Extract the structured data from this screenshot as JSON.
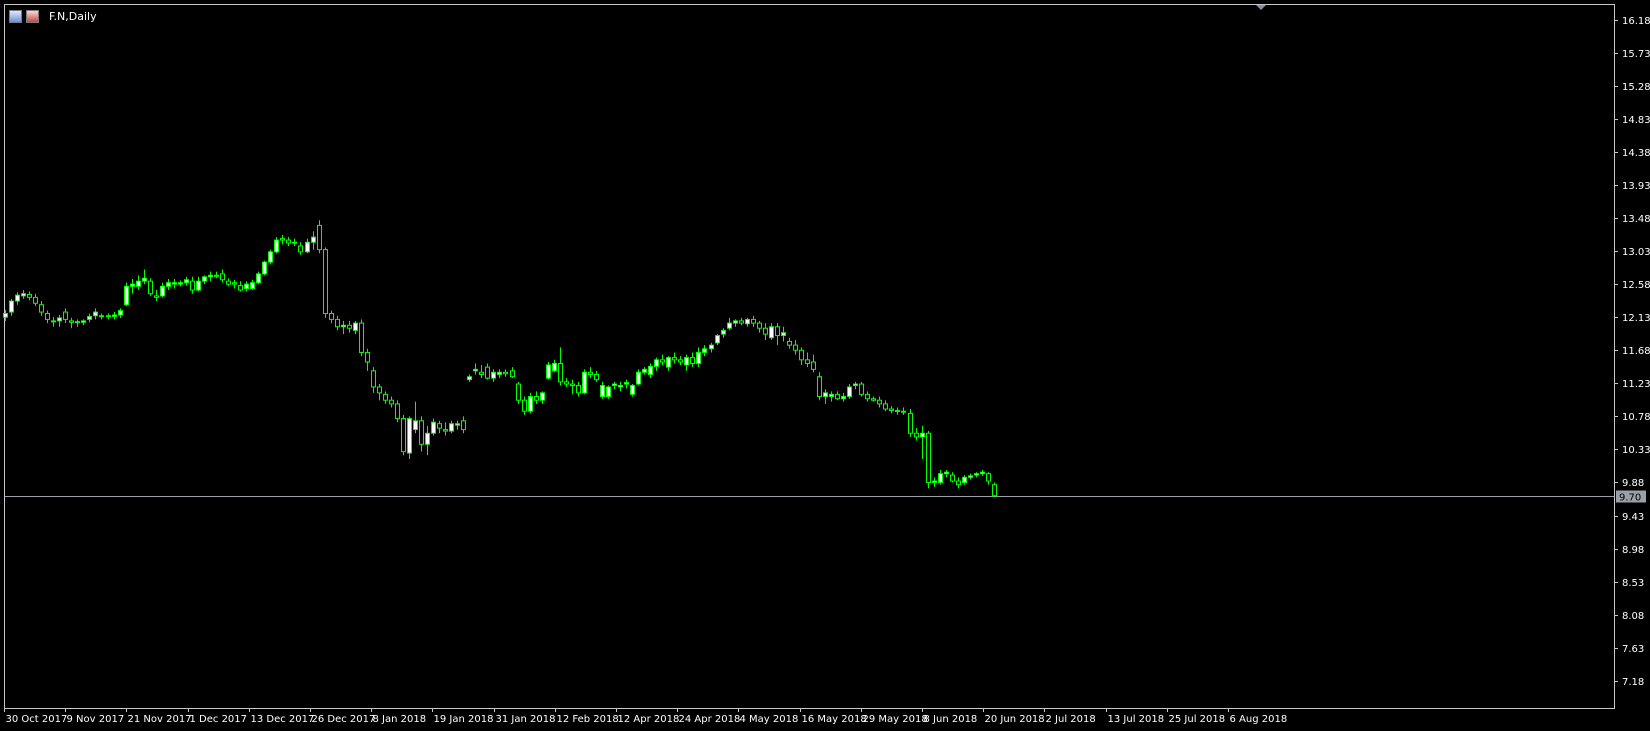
{
  "window": {
    "title": "F.N,Daily",
    "icons": [
      "chart-window-icon",
      "flag-icon"
    ]
  },
  "colors": {
    "background": "#000000",
    "frame": "#c8c8c8",
    "bull_candle": "#00ff00",
    "bull_body": "#ffffff",
    "bear_body": "#000000",
    "price_line": "#9aa0a8",
    "axis_text": "#ffffff"
  },
  "chart_data": {
    "type": "candlestick",
    "title": "F.N,Daily",
    "ylim": [
      6.81,
      16.38
    ],
    "y_ticks": [
      "16.18",
      "15.73",
      "15.28",
      "14.83",
      "14.38",
      "13.93",
      "13.48",
      "13.03",
      "12.58",
      "12.13",
      "11.68",
      "11.23",
      "10.78",
      "10.33",
      "9.88",
      "9.43",
      "8.98",
      "8.53",
      "8.08",
      "7.63",
      "7.18"
    ],
    "x_labels": [
      "30 Oct 2017",
      "9 Nov 2017",
      "21 Nov 2017",
      "1 Dec 2017",
      "13 Dec 2017",
      "26 Dec 2017",
      "8 Jan 2018",
      "19 Jan 2018",
      "31 Jan 2018",
      "12 Feb 2018",
      "12 Apr 2018",
      "24 Apr 2018",
      "4 May 2018",
      "16 May 2018",
      "29 May 2018",
      "8 Jun 2018",
      "20 Jun 2018",
      "2 Jul 2018",
      "13 Jul 2018",
      "25 Jul 2018",
      "6 Aug 2018"
    ],
    "current_price": "9.70",
    "candles": [
      {
        "o": 12.13,
        "h": 12.23,
        "l": 12.08,
        "c": 12.18
      },
      {
        "o": 12.2,
        "h": 12.38,
        "l": 12.15,
        "c": 12.35
      },
      {
        "o": 12.35,
        "h": 12.47,
        "l": 12.3,
        "c": 12.43
      },
      {
        "o": 12.42,
        "h": 12.5,
        "l": 12.38,
        "c": 12.45
      },
      {
        "o": 12.44,
        "h": 12.48,
        "l": 12.36,
        "c": 12.4
      },
      {
        "o": 12.4,
        "h": 12.45,
        "l": 12.28,
        "c": 12.32
      },
      {
        "o": 12.3,
        "h": 12.35,
        "l": 12.15,
        "c": 12.2
      },
      {
        "o": 12.18,
        "h": 12.22,
        "l": 12.05,
        "c": 12.1
      },
      {
        "o": 12.08,
        "h": 12.13,
        "l": 12.0,
        "c": 12.08
      },
      {
        "o": 12.08,
        "h": 12.16,
        "l": 12.0,
        "c": 12.12
      },
      {
        "o": 12.2,
        "h": 12.25,
        "l": 12.05,
        "c": 12.1
      },
      {
        "o": 12.08,
        "h": 12.12,
        "l": 11.98,
        "c": 12.06
      },
      {
        "o": 12.06,
        "h": 12.1,
        "l": 12.0,
        "c": 12.07
      },
      {
        "o": 12.06,
        "h": 12.1,
        "l": 12.02,
        "c": 12.08
      },
      {
        "o": 12.1,
        "h": 12.18,
        "l": 12.06,
        "c": 12.14
      },
      {
        "o": 12.15,
        "h": 12.25,
        "l": 12.1,
        "c": 12.2
      },
      {
        "o": 12.15,
        "h": 12.18,
        "l": 12.1,
        "c": 12.15
      },
      {
        "o": 12.15,
        "h": 12.18,
        "l": 12.1,
        "c": 12.14
      },
      {
        "o": 12.14,
        "h": 12.2,
        "l": 12.1,
        "c": 12.16
      },
      {
        "o": 12.16,
        "h": 12.25,
        "l": 12.12,
        "c": 12.22
      },
      {
        "o": 12.3,
        "h": 12.6,
        "l": 12.28,
        "c": 12.55
      },
      {
        "o": 12.55,
        "h": 12.65,
        "l": 12.45,
        "c": 12.58
      },
      {
        "o": 12.55,
        "h": 12.7,
        "l": 12.5,
        "c": 12.62
      },
      {
        "o": 12.62,
        "h": 12.78,
        "l": 12.58,
        "c": 12.66
      },
      {
        "o": 12.62,
        "h": 12.66,
        "l": 12.42,
        "c": 12.45
      },
      {
        "o": 12.42,
        "h": 12.5,
        "l": 12.35,
        "c": 12.4
      },
      {
        "o": 12.42,
        "h": 12.6,
        "l": 12.4,
        "c": 12.55
      },
      {
        "o": 12.55,
        "h": 12.65,
        "l": 12.5,
        "c": 12.6
      },
      {
        "o": 12.58,
        "h": 12.65,
        "l": 12.52,
        "c": 12.6
      },
      {
        "o": 12.58,
        "h": 12.63,
        "l": 12.55,
        "c": 12.6
      },
      {
        "o": 12.6,
        "h": 12.68,
        "l": 12.56,
        "c": 12.64
      },
      {
        "o": 12.62,
        "h": 12.68,
        "l": 12.45,
        "c": 12.5
      },
      {
        "o": 12.5,
        "h": 12.68,
        "l": 12.48,
        "c": 12.62
      },
      {
        "o": 12.62,
        "h": 12.7,
        "l": 12.58,
        "c": 12.68
      },
      {
        "o": 12.68,
        "h": 12.75,
        "l": 12.62,
        "c": 12.7
      },
      {
        "o": 12.7,
        "h": 12.75,
        "l": 12.66,
        "c": 12.7
      },
      {
        "o": 12.72,
        "h": 12.78,
        "l": 12.6,
        "c": 12.64
      },
      {
        "o": 12.62,
        "h": 12.66,
        "l": 12.55,
        "c": 12.58
      },
      {
        "o": 12.6,
        "h": 12.64,
        "l": 12.52,
        "c": 12.58
      },
      {
        "o": 12.56,
        "h": 12.62,
        "l": 12.48,
        "c": 12.5
      },
      {
        "o": 12.52,
        "h": 12.62,
        "l": 12.48,
        "c": 12.58
      },
      {
        "o": 12.52,
        "h": 12.64,
        "l": 12.5,
        "c": 12.6
      },
      {
        "o": 12.6,
        "h": 12.75,
        "l": 12.58,
        "c": 12.72
      },
      {
        "o": 12.72,
        "h": 12.9,
        "l": 12.7,
        "c": 12.88
      },
      {
        "o": 12.88,
        "h": 13.05,
        "l": 12.85,
        "c": 13.02
      },
      {
        "o": 13.02,
        "h": 13.22,
        "l": 13.0,
        "c": 13.18
      },
      {
        "o": 13.2,
        "h": 13.25,
        "l": 13.12,
        "c": 13.18
      },
      {
        "o": 13.18,
        "h": 13.22,
        "l": 13.1,
        "c": 13.14
      },
      {
        "o": 13.14,
        "h": 13.2,
        "l": 13.1,
        "c": 13.15
      },
      {
        "o": 13.1,
        "h": 13.15,
        "l": 12.98,
        "c": 13.02
      },
      {
        "o": 13.02,
        "h": 13.2,
        "l": 13.0,
        "c": 13.15
      },
      {
        "o": 13.15,
        "h": 13.3,
        "l": 13.05,
        "c": 13.22
      },
      {
        "o": 13.38,
        "h": 13.45,
        "l": 13.0,
        "c": 13.05
      },
      {
        "o": 13.05,
        "h": 13.08,
        "l": 12.12,
        "c": 12.18
      },
      {
        "o": 12.18,
        "h": 12.22,
        "l": 12.05,
        "c": 12.1
      },
      {
        "o": 12.1,
        "h": 12.15,
        "l": 11.95,
        "c": 12.0
      },
      {
        "o": 12.0,
        "h": 12.08,
        "l": 11.9,
        "c": 12.02
      },
      {
        "o": 12.02,
        "h": 12.08,
        "l": 11.92,
        "c": 11.98
      },
      {
        "o": 11.95,
        "h": 12.08,
        "l": 11.9,
        "c": 12.05
      },
      {
        "o": 12.05,
        "h": 12.1,
        "l": 11.6,
        "c": 11.65
      },
      {
        "o": 11.65,
        "h": 11.7,
        "l": 11.4,
        "c": 11.52
      },
      {
        "o": 11.4,
        "h": 11.45,
        "l": 11.1,
        "c": 11.18
      },
      {
        "o": 11.18,
        "h": 11.22,
        "l": 11.0,
        "c": 11.1
      },
      {
        "o": 11.08,
        "h": 11.12,
        "l": 10.95,
        "c": 11.0
      },
      {
        "o": 11.0,
        "h": 11.05,
        "l": 10.9,
        "c": 10.95
      },
      {
        "o": 10.95,
        "h": 11.0,
        "l": 10.7,
        "c": 10.75
      },
      {
        "o": 10.75,
        "h": 10.8,
        "l": 10.25,
        "c": 10.3
      },
      {
        "o": 10.28,
        "h": 10.78,
        "l": 10.2,
        "c": 10.75
      },
      {
        "o": 10.6,
        "h": 10.98,
        "l": 10.55,
        "c": 10.72
      },
      {
        "o": 10.72,
        "h": 10.78,
        "l": 10.3,
        "c": 10.4
      },
      {
        "o": 10.4,
        "h": 10.65,
        "l": 10.25,
        "c": 10.55
      },
      {
        "o": 10.55,
        "h": 10.75,
        "l": 10.52,
        "c": 10.7
      },
      {
        "o": 10.68,
        "h": 10.72,
        "l": 10.55,
        "c": 10.62
      },
      {
        "o": 10.6,
        "h": 10.7,
        "l": 10.52,
        "c": 10.58
      },
      {
        "o": 10.58,
        "h": 10.72,
        "l": 10.55,
        "c": 10.68
      },
      {
        "o": 10.66,
        "h": 10.72,
        "l": 10.6,
        "c": 10.68
      },
      {
        "o": 10.72,
        "h": 10.78,
        "l": 10.55,
        "c": 10.6
      },
      {
        "o": 11.28,
        "h": 11.35,
        "l": 11.25,
        "c": 11.32
      },
      {
        "o": 11.4,
        "h": 11.5,
        "l": 11.35,
        "c": 11.42
      },
      {
        "o": 11.38,
        "h": 11.48,
        "l": 11.3,
        "c": 11.35
      },
      {
        "o": 11.45,
        "h": 11.5,
        "l": 11.28,
        "c": 11.3
      },
      {
        "o": 11.3,
        "h": 11.42,
        "l": 11.25,
        "c": 11.38
      },
      {
        "o": 11.35,
        "h": 11.42,
        "l": 11.3,
        "c": 11.38
      },
      {
        "o": 11.38,
        "h": 11.42,
        "l": 11.32,
        "c": 11.36
      },
      {
        "o": 11.4,
        "h": 11.45,
        "l": 11.3,
        "c": 11.32
      },
      {
        "o": 11.22,
        "h": 11.25,
        "l": 10.95,
        "c": 11.0
      },
      {
        "o": 11.0,
        "h": 11.05,
        "l": 10.8,
        "c": 10.85
      },
      {
        "o": 10.85,
        "h": 11.1,
        "l": 10.82,
        "c": 11.05
      },
      {
        "o": 11.05,
        "h": 11.12,
        "l": 10.95,
        "c": 11.0
      },
      {
        "o": 11.0,
        "h": 11.12,
        "l": 10.95,
        "c": 11.1
      },
      {
        "o": 11.3,
        "h": 11.52,
        "l": 11.28,
        "c": 11.48
      },
      {
        "o": 11.4,
        "h": 11.55,
        "l": 11.38,
        "c": 11.5
      },
      {
        "o": 11.5,
        "h": 11.72,
        "l": 11.2,
        "c": 11.25
      },
      {
        "o": 11.25,
        "h": 11.3,
        "l": 11.18,
        "c": 11.22
      },
      {
        "o": 11.22,
        "h": 11.28,
        "l": 11.08,
        "c": 11.2
      },
      {
        "o": 11.2,
        "h": 11.25,
        "l": 11.05,
        "c": 11.1
      },
      {
        "o": 11.1,
        "h": 11.42,
        "l": 11.08,
        "c": 11.38
      },
      {
        "o": 11.38,
        "h": 11.45,
        "l": 11.3,
        "c": 11.35
      },
      {
        "o": 11.35,
        "h": 11.4,
        "l": 11.25,
        "c": 11.28
      },
      {
        "o": 11.05,
        "h": 11.25,
        "l": 11.02,
        "c": 11.2
      },
      {
        "o": 11.05,
        "h": 11.2,
        "l": 11.02,
        "c": 11.18
      },
      {
        "o": 11.2,
        "h": 11.25,
        "l": 11.15,
        "c": 11.22
      },
      {
        "o": 11.18,
        "h": 11.25,
        "l": 11.12,
        "c": 11.2
      },
      {
        "o": 11.22,
        "h": 11.28,
        "l": 11.16,
        "c": 11.24
      },
      {
        "o": 11.08,
        "h": 11.22,
        "l": 11.05,
        "c": 11.2
      },
      {
        "o": 11.22,
        "h": 11.42,
        "l": 11.2,
        "c": 11.38
      },
      {
        "o": 11.38,
        "h": 11.45,
        "l": 11.35,
        "c": 11.42
      },
      {
        "o": 11.35,
        "h": 11.5,
        "l": 11.3,
        "c": 11.46
      },
      {
        "o": 11.46,
        "h": 11.58,
        "l": 11.4,
        "c": 11.55
      },
      {
        "o": 11.55,
        "h": 11.62,
        "l": 11.48,
        "c": 11.52
      },
      {
        "o": 11.45,
        "h": 11.6,
        "l": 11.4,
        "c": 11.58
      },
      {
        "o": 11.58,
        "h": 11.65,
        "l": 11.5,
        "c": 11.55
      },
      {
        "o": 11.55,
        "h": 11.6,
        "l": 11.48,
        "c": 11.52
      },
      {
        "o": 11.48,
        "h": 11.62,
        "l": 11.4,
        "c": 11.58
      },
      {
        "o": 11.58,
        "h": 11.65,
        "l": 11.45,
        "c": 11.5
      },
      {
        "o": 11.5,
        "h": 11.72,
        "l": 11.45,
        "c": 11.65
      },
      {
        "o": 11.65,
        "h": 11.75,
        "l": 11.6,
        "c": 11.7
      },
      {
        "o": 11.7,
        "h": 11.78,
        "l": 11.65,
        "c": 11.75
      },
      {
        "o": 11.78,
        "h": 11.9,
        "l": 11.75,
        "c": 11.88
      },
      {
        "o": 11.9,
        "h": 11.98,
        "l": 11.85,
        "c": 11.95
      },
      {
        "o": 11.98,
        "h": 12.12,
        "l": 11.95,
        "c": 12.05
      },
      {
        "o": 12.05,
        "h": 12.1,
        "l": 12.0,
        "c": 12.08
      },
      {
        "o": 12.08,
        "h": 12.12,
        "l": 12.02,
        "c": 12.05
      },
      {
        "o": 12.04,
        "h": 12.12,
        "l": 12.0,
        "c": 12.1
      },
      {
        "o": 12.1,
        "h": 12.15,
        "l": 12.0,
        "c": 12.05
      },
      {
        "o": 12.05,
        "h": 12.08,
        "l": 11.92,
        "c": 11.98
      },
      {
        "o": 11.98,
        "h": 12.05,
        "l": 11.82,
        "c": 11.9
      },
      {
        "o": 11.85,
        "h": 12.05,
        "l": 11.82,
        "c": 12.0
      },
      {
        "o": 12.0,
        "h": 12.05,
        "l": 11.75,
        "c": 11.88
      },
      {
        "o": 11.88,
        "h": 12.0,
        "l": 11.8,
        "c": 11.92
      },
      {
        "o": 11.8,
        "h": 11.85,
        "l": 11.7,
        "c": 11.75
      },
      {
        "o": 11.75,
        "h": 11.82,
        "l": 11.62,
        "c": 11.68
      },
      {
        "o": 11.68,
        "h": 11.72,
        "l": 11.48,
        "c": 11.55
      },
      {
        "o": 11.55,
        "h": 11.65,
        "l": 11.45,
        "c": 11.5
      },
      {
        "o": 11.52,
        "h": 11.62,
        "l": 11.38,
        "c": 11.42
      },
      {
        "o": 11.32,
        "h": 11.38,
        "l": 11.0,
        "c": 11.05
      },
      {
        "o": 11.05,
        "h": 11.15,
        "l": 10.95,
        "c": 11.1
      },
      {
        "o": 11.05,
        "h": 11.12,
        "l": 10.98,
        "c": 11.08
      },
      {
        "o": 11.08,
        "h": 11.12,
        "l": 11.0,
        "c": 11.02
      },
      {
        "o": 11.02,
        "h": 11.1,
        "l": 10.98,
        "c": 11.05
      },
      {
        "o": 11.05,
        "h": 11.22,
        "l": 11.02,
        "c": 11.18
      },
      {
        "o": 11.2,
        "h": 11.25,
        "l": 11.15,
        "c": 11.22
      },
      {
        "o": 11.22,
        "h": 11.25,
        "l": 11.05,
        "c": 11.08
      },
      {
        "o": 11.08,
        "h": 11.12,
        "l": 10.98,
        "c": 11.02
      },
      {
        "o": 11.02,
        "h": 11.05,
        "l": 10.98,
        "c": 11.0
      },
      {
        "o": 11.0,
        "h": 11.05,
        "l": 10.9,
        "c": 10.95
      },
      {
        "o": 10.95,
        "h": 11.0,
        "l": 10.85,
        "c": 10.88
      },
      {
        "o": 10.88,
        "h": 10.92,
        "l": 10.82,
        "c": 10.86
      },
      {
        "o": 10.86,
        "h": 10.9,
        "l": 10.8,
        "c": 10.85
      },
      {
        "o": 10.85,
        "h": 10.9,
        "l": 10.8,
        "c": 10.84
      },
      {
        "o": 10.82,
        "h": 10.88,
        "l": 10.5,
        "c": 10.55
      },
      {
        "o": 10.55,
        "h": 10.62,
        "l": 10.45,
        "c": 10.5
      },
      {
        "o": 10.5,
        "h": 10.65,
        "l": 10.2,
        "c": 10.55
      },
      {
        "o": 10.55,
        "h": 10.58,
        "l": 9.8,
        "c": 9.88
      },
      {
        "o": 9.88,
        "h": 9.95,
        "l": 9.82,
        "c": 9.9
      },
      {
        "o": 9.88,
        "h": 10.05,
        "l": 9.85,
        "c": 10.0
      },
      {
        "o": 10.0,
        "h": 10.05,
        "l": 9.95,
        "c": 10.02
      },
      {
        "o": 9.98,
        "h": 10.02,
        "l": 9.88,
        "c": 9.9
      },
      {
        "o": 9.9,
        "h": 9.95,
        "l": 9.8,
        "c": 9.85
      },
      {
        "o": 9.88,
        "h": 9.98,
        "l": 9.85,
        "c": 9.95
      },
      {
        "o": 9.95,
        "h": 10.0,
        "l": 9.92,
        "c": 9.97
      },
      {
        "o": 9.98,
        "h": 10.02,
        "l": 9.95,
        "c": 10.0
      },
      {
        "o": 10.0,
        "h": 10.05,
        "l": 9.97,
        "c": 10.02
      },
      {
        "o": 10.0,
        "h": 10.02,
        "l": 9.85,
        "c": 9.9
      },
      {
        "o": 9.85,
        "h": 9.88,
        "l": 9.68,
        "c": 9.7
      }
    ]
  }
}
